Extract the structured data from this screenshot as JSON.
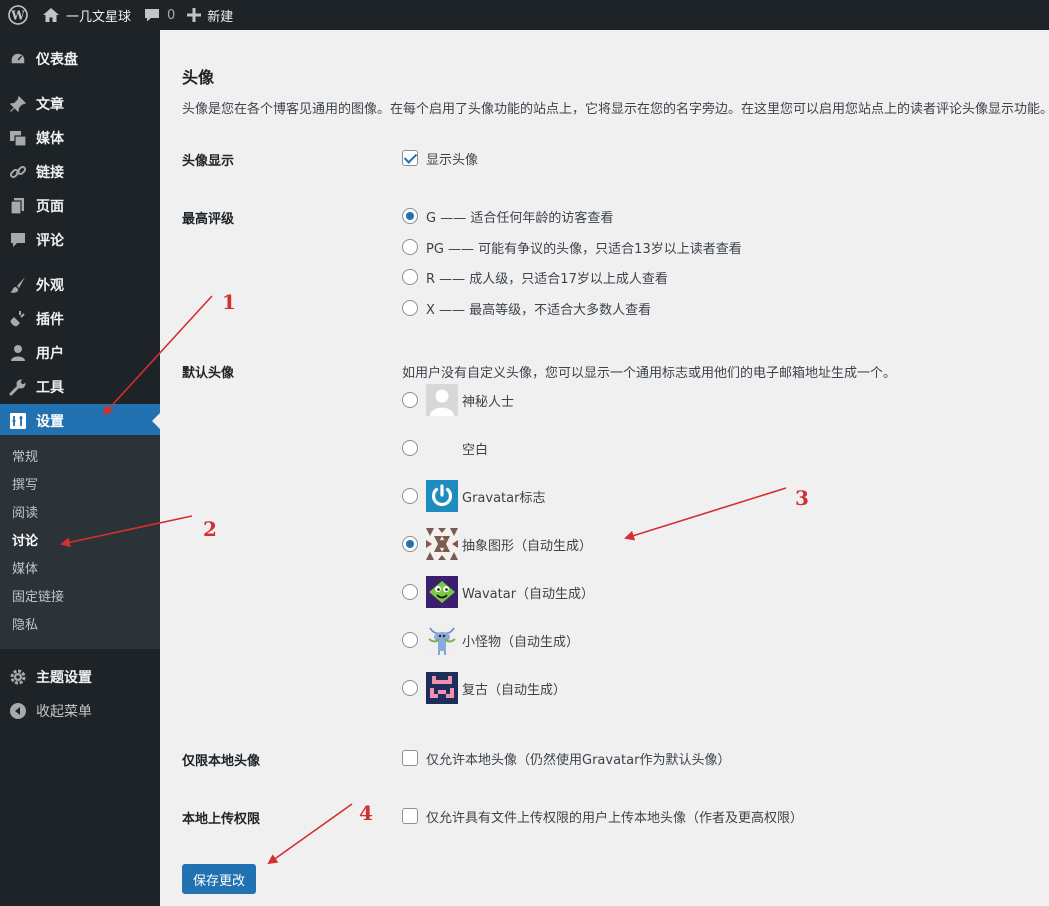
{
  "admin_bar": {
    "site_name": "一几文星球",
    "comments_count": "0",
    "new_label": "新建"
  },
  "sidebar": {
    "items": [
      {
        "label": "仪表盘",
        "icon": "dashboard-icon"
      },
      {
        "label": "文章",
        "icon": "pin-icon"
      },
      {
        "label": "媒体",
        "icon": "media-icon"
      },
      {
        "label": "链接",
        "icon": "link-icon"
      },
      {
        "label": "页面",
        "icon": "page-icon"
      },
      {
        "label": "评论",
        "icon": "comment-icon"
      },
      {
        "label": "外观",
        "icon": "brush-icon"
      },
      {
        "label": "插件",
        "icon": "plugin-icon"
      },
      {
        "label": "用户",
        "icon": "user-icon"
      },
      {
        "label": "工具",
        "icon": "wrench-icon"
      },
      {
        "label": "设置",
        "icon": "settings-icon"
      }
    ],
    "submenu": [
      "常规",
      "撰写",
      "阅读",
      "讨论",
      "媒体",
      "固定链接",
      "隐私"
    ],
    "current_submenu": "讨论",
    "theme_settings": "主题设置",
    "collapse_menu": "收起菜单"
  },
  "main": {
    "title": "头像",
    "description": "头像是您在各个博客见通用的图像。在每个启用了头像功能的站点上，它将显示在您的名字旁边。在这里您可以启用您站点上的读者评论头像显示功能。",
    "show_avatars": {
      "label": "头像显示",
      "option": "显示头像",
      "checked": true
    },
    "max_rating": {
      "label": "最高评级",
      "options": [
        "G —— 适合任何年龄的访客查看",
        "PG —— 可能有争议的头像，只适合13岁以上读者查看",
        "R —— 成人级，只适合17岁以上成人查看",
        "X —— 最高等级，不适合大多数人查看"
      ],
      "selected": "G —— 适合任何年龄的访客查看"
    },
    "default_avatar": {
      "label": "默认头像",
      "hint": "如用户没有自定义头像，您可以显示一个通用标志或用他们的电子邮箱地址生成一个。",
      "options": [
        "神秘人士",
        "空白",
        "Gravatar标志",
        "抽象图形（自动生成）",
        "Wavatar（自动生成）",
        "小怪物（自动生成）",
        "复古（自动生成）"
      ],
      "selected": "抽象图形（自动生成）"
    },
    "local_only": {
      "label": "仅限本地头像",
      "option": "仅允许本地头像（仍然使用Gravatar作为默认头像）",
      "checked": false
    },
    "upload_permission": {
      "label": "本地上传权限",
      "option": "仅允许具有文件上传权限的用户上传本地头像（作者及更高权限）",
      "checked": false
    },
    "save_label": "保存更改"
  },
  "annotations": [
    "1",
    "2",
    "3",
    "4"
  ],
  "colors": {
    "sidebar_bg": "#1d2327",
    "submenu_bg": "#2c3338",
    "accent": "#2271b1",
    "annotation": "#d32f2f",
    "content_bg": "#f0f0f1"
  }
}
